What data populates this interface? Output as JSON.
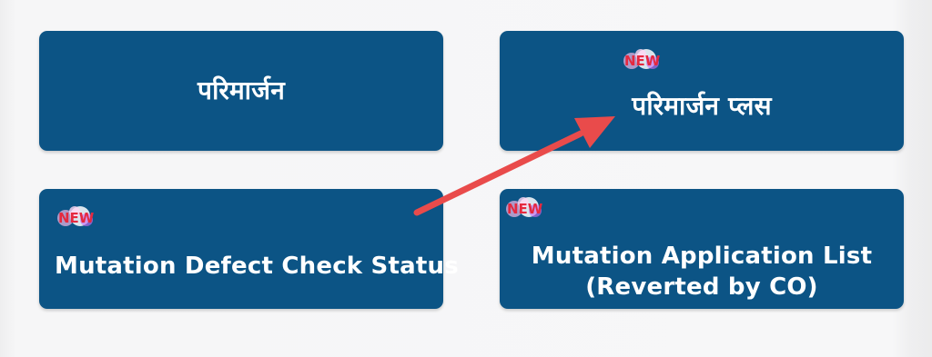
{
  "tiles": {
    "parimarjan": {
      "label": "परिमार्जन"
    },
    "parimarjan_plus": {
      "label": "परिमार्जन प्लस",
      "badge": "NEW"
    },
    "defect_status": {
      "label": "Mutation Defect Check Status",
      "badge": "NEW"
    },
    "application_list": {
      "label_line1": "Mutation Application List",
      "label_line2": "(Reverted by CO)",
      "badge": "NEW"
    }
  },
  "colors": {
    "tile_background": "#0c5485",
    "page_background": "#f3f3f4",
    "arrow": "#e94b4b",
    "badge_text": "#e5293f"
  },
  "icons": {
    "badge": "new-badge-icon",
    "annotation": "arrow-annotation-icon"
  }
}
